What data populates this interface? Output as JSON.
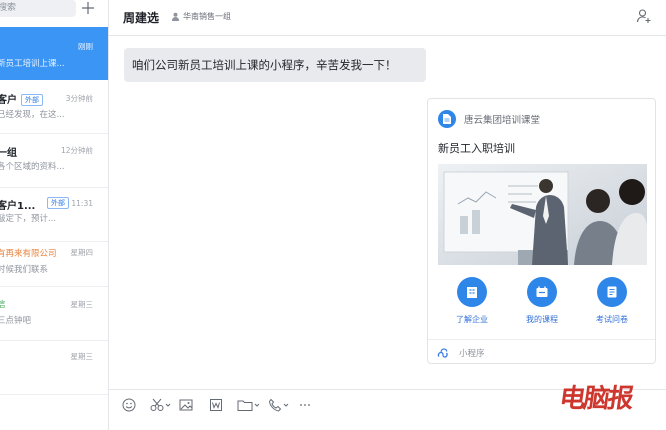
{
  "sidebar": {
    "search_placeholder": "搜索",
    "conversations": [
      {
        "name": "",
        "snippet": "新员工培训上课...",
        "time": "刚刚",
        "tag": "",
        "active": true
      },
      {
        "name": "客户",
        "snippet": "已经发现，在这...",
        "time": "3分钟前",
        "tag": "外部"
      },
      {
        "name": "一组",
        "snippet": "各个区域的资料...",
        "time": "12分钟前",
        "tag": ""
      },
      {
        "name": "客户1...",
        "snippet": "敲定下，预计...",
        "time": "11:31",
        "tag": "外部"
      },
      {
        "name": "有再来有限公司",
        "snippet": "时候我们联系",
        "time": "星期四",
        "tag": "",
        "name_color": "#e8823a"
      },
      {
        "name": "信",
        "snippet": "三点钟吧",
        "time": "星期三",
        "tag": "",
        "name_color": "#3aa655"
      },
      {
        "name": "",
        "snippet": "",
        "time": "星期三",
        "tag": ""
      }
    ]
  },
  "chat": {
    "title": "周建选",
    "department": "华南销售一组",
    "message_in": "咱们公司新员工培训上课的小程序，辛苦发我一下！"
  },
  "card": {
    "brand": "唐云集团培训课堂",
    "title": "新员工入职培训",
    "image_alt": "presenter-at-whiteboard",
    "actions": [
      {
        "label": "了解企业",
        "icon": "building-icon"
      },
      {
        "label": "我的课程",
        "icon": "course-icon"
      },
      {
        "label": "考试问卷",
        "icon": "exam-icon"
      }
    ],
    "footer": "小程序"
  },
  "composer": {
    "tools": [
      "emoji-icon",
      "scissors-icon",
      "image-icon",
      "word-file-icon",
      "folder-icon",
      "phone-icon",
      "more-icon"
    ]
  },
  "watermark": "电脑报",
  "colors": {
    "accent": "#3a95f5",
    "brand_blue": "#2f86e9",
    "watermark_red": "#c9271d"
  }
}
